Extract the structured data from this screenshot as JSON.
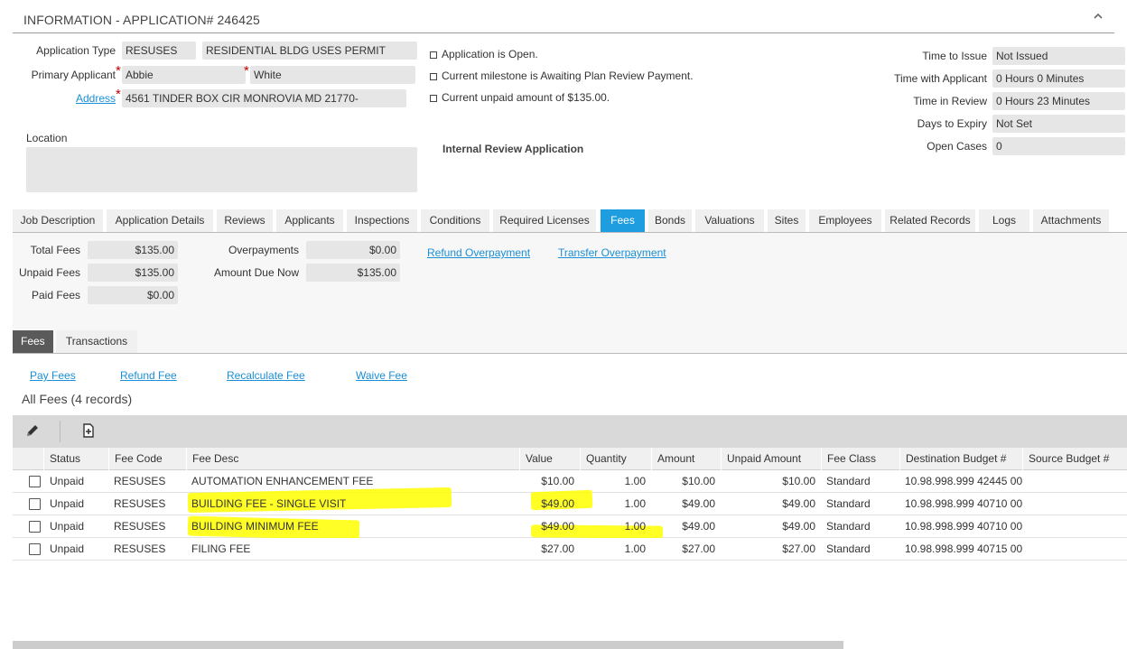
{
  "header": {
    "title": "INFORMATION - APPLICATION# 246425",
    "collapse_icon": "chevron-up-icon"
  },
  "info": {
    "application_type_label": "Application Type",
    "application_type_code": "RESUSES",
    "application_type_desc": "RESIDENTIAL BLDG USES PERMIT",
    "primary_applicant_label": "Primary Applicant",
    "applicant_first": "Abbie",
    "applicant_last": "White",
    "address_label": "Address",
    "address_value": "4561 TINDER BOX CIR MONROVIA MD 21770-",
    "location_label": "Location",
    "location_value": "",
    "status_lines": [
      "Application is Open.",
      "Current milestone is Awaiting Plan Review Payment.",
      "Current unpaid amount of $135.00."
    ],
    "internal_review": "Internal Review Application",
    "metrics": [
      {
        "label": "Time to Issue",
        "value": "Not Issued"
      },
      {
        "label": "Time with Applicant",
        "value": "0 Hours 0 Minutes"
      },
      {
        "label": "Time in Review",
        "value": "0 Hours 23 Minutes"
      },
      {
        "label": "Days to Expiry",
        "value": "Not Set"
      },
      {
        "label": "Open Cases",
        "value": "0"
      }
    ]
  },
  "tabs": [
    {
      "label": "Job Description"
    },
    {
      "label": "Application Details"
    },
    {
      "label": "Reviews"
    },
    {
      "label": "Applicants"
    },
    {
      "label": "Inspections"
    },
    {
      "label": "Conditions"
    },
    {
      "label": "Required Licenses"
    },
    {
      "label": "Fees",
      "active": true
    },
    {
      "label": "Bonds"
    },
    {
      "label": "Valuations"
    },
    {
      "label": "Sites"
    },
    {
      "label": "Employees"
    },
    {
      "label": "Related Records"
    },
    {
      "label": "Logs"
    },
    {
      "label": "Attachments"
    }
  ],
  "fee_summary": {
    "total_fees_label": "Total Fees",
    "total_fees": "$135.00",
    "unpaid_fees_label": "Unpaid Fees",
    "unpaid_fees": "$135.00",
    "paid_fees_label": "Paid Fees",
    "paid_fees": "$0.00",
    "overpayments_label": "Overpayments",
    "overpayments": "$0.00",
    "amount_due_label": "Amount Due Now",
    "amount_due": "$135.00",
    "refund_overpayment": "Refund Overpayment",
    "transfer_overpayment": "Transfer Overpayment"
  },
  "subtabs": [
    {
      "label": "Fees",
      "active": true
    },
    {
      "label": "Transactions"
    }
  ],
  "fee_actions": {
    "pay": "Pay Fees",
    "refund": "Refund Fee",
    "recalculate": "Recalculate Fee",
    "waive": "Waive Fee"
  },
  "grid": {
    "title": "All Fees (4 records)",
    "toolbar_icons": [
      "pencil-icon",
      "add-document-icon"
    ],
    "columns": [
      "Status",
      "Fee Code",
      "Fee Desc",
      "Value",
      "Quantity",
      "Amount",
      "Unpaid Amount",
      "Fee Class",
      "Destination Budget #",
      "Source Budget #"
    ],
    "rows": [
      {
        "status": "Unpaid",
        "code": "RESUSES",
        "desc": "AUTOMATION ENHANCEMENT FEE",
        "value": "$10.00",
        "qty": "1.00",
        "amount": "$10.00",
        "unpaid": "$10.00",
        "class": "Standard",
        "dest": "10.98.998.999 42445 00",
        "source": ""
      },
      {
        "status": "Unpaid",
        "code": "RESUSES",
        "desc": "BUILDING FEE - SINGLE VISIT",
        "value": "$49.00",
        "qty": "1.00",
        "amount": "$49.00",
        "unpaid": "$49.00",
        "class": "Standard",
        "dest": "10.98.998.999 40710 00",
        "source": ""
      },
      {
        "status": "Unpaid",
        "code": "RESUSES",
        "desc": "BUILDING MINIMUM FEE",
        "value": "$49.00",
        "qty": "1.00",
        "amount": "$49.00",
        "unpaid": "$49.00",
        "class": "Standard",
        "dest": "10.98.998.999 40710 00",
        "source": ""
      },
      {
        "status": "Unpaid",
        "code": "RESUSES",
        "desc": "FILING FEE",
        "value": "$27.00",
        "qty": "1.00",
        "amount": "$27.00",
        "unpaid": "$27.00",
        "class": "Standard",
        "dest": "10.98.998.999 40715 00",
        "source": ""
      }
    ]
  },
  "colors": {
    "accent": "#1e9de0",
    "link": "#1a8fd6",
    "highlight": "#ffff00",
    "required": "#c00000"
  }
}
